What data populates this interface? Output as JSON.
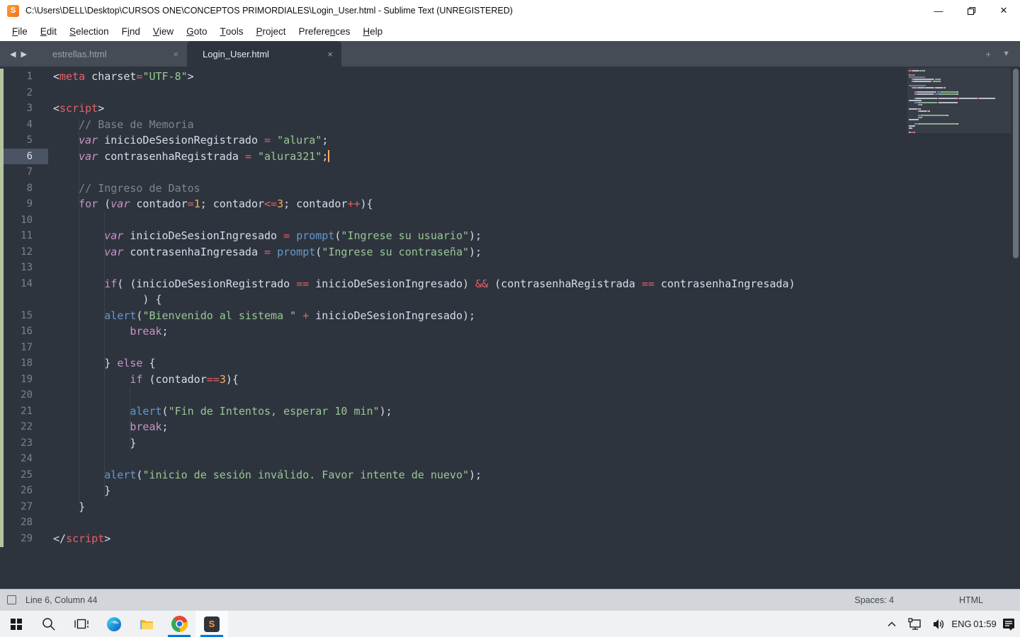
{
  "window": {
    "title": "C:\\Users\\DELL\\Desktop\\CURSOS ONE\\CONCEPTOS PRIMORDIALES\\Login_User.html - Sublime Text (UNREGISTERED)"
  },
  "icons": {
    "logo": "S",
    "close_tab": "×",
    "new_tab": "+",
    "overflow": "▼",
    "prev": "◀",
    "next": "▶",
    "minimize": "—",
    "close_window": "✕"
  },
  "menu": {
    "items": [
      {
        "name": "file",
        "pre": "",
        "u": "F",
        "post": "ile"
      },
      {
        "name": "edit",
        "pre": "",
        "u": "E",
        "post": "dit"
      },
      {
        "name": "selection",
        "pre": "",
        "u": "S",
        "post": "election"
      },
      {
        "name": "find",
        "pre": "F",
        "u": "i",
        "post": "nd"
      },
      {
        "name": "view",
        "pre": "",
        "u": "V",
        "post": "iew"
      },
      {
        "name": "goto",
        "pre": "",
        "u": "G",
        "post": "oto"
      },
      {
        "name": "tools",
        "pre": "",
        "u": "T",
        "post": "ools"
      },
      {
        "name": "project",
        "pre": "",
        "u": "P",
        "post": "roject"
      },
      {
        "name": "preferences",
        "pre": "Prefere",
        "u": "n",
        "post": "ces"
      },
      {
        "name": "help",
        "pre": "",
        "u": "H",
        "post": "elp"
      }
    ]
  },
  "tabs": {
    "items": [
      {
        "label": "estrellas.html",
        "active": false
      },
      {
        "label": "Login_User.html",
        "active": true
      }
    ]
  },
  "editor": {
    "caret": "#f9ae58",
    "gutter_added": "#b2c59f",
    "palette": {
      "pun": "#d8dee9",
      "kw": "#c695c6",
      "kwi": "#c695c6",
      "op": "#ec5f66",
      "num": "#f9ae58",
      "str": "#99c794",
      "fn": "#6699cc",
      "com": "#7d858f",
      "tag": "#ec5f66"
    },
    "rows": [
      {
        "n": "1",
        "t": [
          [
            "pun",
            "<"
          ],
          [
            "tag",
            "meta"
          ],
          [
            "pun",
            " charset"
          ],
          [
            "op",
            "="
          ],
          [
            "str",
            "\"UTF-8\""
          ],
          [
            "pun",
            ">"
          ]
        ]
      },
      {
        "n": "2",
        "t": []
      },
      {
        "n": "3",
        "t": [
          [
            "pun",
            "<"
          ],
          [
            "tag",
            "script"
          ],
          [
            "pun",
            ">"
          ]
        ]
      },
      {
        "n": "4",
        "t": [
          [
            "com",
            "    // Base de Memoria"
          ]
        ]
      },
      {
        "n": "5",
        "t": [
          [
            "pun",
            "    "
          ],
          [
            "kwi",
            "var"
          ],
          [
            "pun",
            " inicioDeSesionRegistrado "
          ],
          [
            "op",
            "="
          ],
          [
            "pun",
            " "
          ],
          [
            "str",
            "\"alura\""
          ],
          [
            "pun",
            ";"
          ]
        ]
      },
      {
        "n": "6",
        "cur": true,
        "t": [
          [
            "pun",
            "    "
          ],
          [
            "kwi",
            "var"
          ],
          [
            "pun",
            " contrasenhaRegistrada "
          ],
          [
            "op",
            "="
          ],
          [
            "pun",
            " "
          ],
          [
            "str",
            "\"alura321\""
          ],
          [
            "pun",
            ";"
          ]
        ]
      },
      {
        "n": "7",
        "t": []
      },
      {
        "n": "8",
        "t": [
          [
            "com",
            "    // Ingreso de Datos"
          ]
        ]
      },
      {
        "n": "9",
        "t": [
          [
            "pun",
            "    "
          ],
          [
            "kw",
            "for"
          ],
          [
            "pun",
            " ("
          ],
          [
            "kwi",
            "var"
          ],
          [
            "pun",
            " contador"
          ],
          [
            "op",
            "="
          ],
          [
            "num",
            "1"
          ],
          [
            "pun",
            "; contador"
          ],
          [
            "op",
            "<="
          ],
          [
            "num",
            "3"
          ],
          [
            "pun",
            "; contador"
          ],
          [
            "op",
            "++"
          ],
          [
            "pun",
            "){"
          ]
        ]
      },
      {
        "n": "10",
        "t": []
      },
      {
        "n": "11",
        "t": [
          [
            "pun",
            "        "
          ],
          [
            "kwi",
            "var"
          ],
          [
            "pun",
            " inicioDeSesionIngresado "
          ],
          [
            "op",
            "="
          ],
          [
            "pun",
            " "
          ],
          [
            "fn",
            "prompt"
          ],
          [
            "pun",
            "("
          ],
          [
            "str",
            "\"Ingrese su usuario\""
          ],
          [
            "pun",
            ");"
          ]
        ]
      },
      {
        "n": "12",
        "t": [
          [
            "pun",
            "        "
          ],
          [
            "kwi",
            "var"
          ],
          [
            "pun",
            " contrasenhaIngresada "
          ],
          [
            "op",
            "="
          ],
          [
            "pun",
            " "
          ],
          [
            "fn",
            "prompt"
          ],
          [
            "pun",
            "("
          ],
          [
            "str",
            "\"Ingrese su contraseña\""
          ],
          [
            "pun",
            ");"
          ]
        ]
      },
      {
        "n": "13",
        "t": []
      },
      {
        "n": "14",
        "t": [
          [
            "pun",
            "        "
          ],
          [
            "kw",
            "if"
          ],
          [
            "pun",
            "( (inicioDeSesionRegistrado "
          ],
          [
            "op",
            "=="
          ],
          [
            "pun",
            " inicioDeSesionIngresado) "
          ],
          [
            "op",
            "&&"
          ],
          [
            "pun",
            " (contrasenhaRegistrada "
          ],
          [
            "op",
            "=="
          ],
          [
            "pun",
            " contrasenhaIngresada)"
          ]
        ]
      },
      {
        "n": "",
        "t": [
          [
            "pun",
            "              ) {"
          ]
        ]
      },
      {
        "n": "15",
        "t": [
          [
            "pun",
            "        "
          ],
          [
            "fn",
            "alert"
          ],
          [
            "pun",
            "("
          ],
          [
            "str",
            "\"Bienvenido al sistema \""
          ],
          [
            "pun",
            " "
          ],
          [
            "op",
            "+"
          ],
          [
            "pun",
            " inicioDeSesionIngresado);"
          ]
        ]
      },
      {
        "n": "16",
        "t": [
          [
            "pun",
            "            "
          ],
          [
            "kw",
            "break"
          ],
          [
            "pun",
            ";"
          ]
        ]
      },
      {
        "n": "17",
        "t": []
      },
      {
        "n": "18",
        "t": [
          [
            "pun",
            "        } "
          ],
          [
            "kw",
            "else"
          ],
          [
            "pun",
            " {"
          ]
        ]
      },
      {
        "n": "19",
        "t": [
          [
            "pun",
            "            "
          ],
          [
            "kw",
            "if"
          ],
          [
            "pun",
            " (contador"
          ],
          [
            "op",
            "=="
          ],
          [
            "num",
            "3"
          ],
          [
            "pun",
            "){"
          ]
        ]
      },
      {
        "n": "20",
        "t": []
      },
      {
        "n": "21",
        "t": [
          [
            "pun",
            "            "
          ],
          [
            "fn",
            "alert"
          ],
          [
            "pun",
            "("
          ],
          [
            "str",
            "\"Fin de Intentos, esperar 10 min\""
          ],
          [
            "pun",
            ");"
          ]
        ]
      },
      {
        "n": "22",
        "t": [
          [
            "pun",
            "            "
          ],
          [
            "kw",
            "break"
          ],
          [
            "pun",
            ";"
          ]
        ]
      },
      {
        "n": "23",
        "t": [
          [
            "pun",
            "            }"
          ]
        ]
      },
      {
        "n": "24",
        "t": []
      },
      {
        "n": "25",
        "t": [
          [
            "pun",
            "        "
          ],
          [
            "fn",
            "alert"
          ],
          [
            "pun",
            "("
          ],
          [
            "str",
            "\"inicio de sesión inválido. Favor intente de nuevo\""
          ],
          [
            "pun",
            ");"
          ]
        ]
      },
      {
        "n": "26",
        "t": [
          [
            "pun",
            "        }"
          ]
        ]
      },
      {
        "n": "27",
        "t": [
          [
            "pun",
            "    }"
          ]
        ]
      },
      {
        "n": "28",
        "t": []
      },
      {
        "n": "29",
        "t": [
          [
            "pun",
            "</"
          ],
          [
            "tag",
            "script"
          ],
          [
            "pun",
            ">"
          ]
        ]
      }
    ]
  },
  "status": {
    "position": "Line 6, Column 44",
    "indent": "Spaces: 4",
    "syntax": "HTML"
  },
  "taskbar": {
    "language": "ENG",
    "time": "01:59"
  }
}
